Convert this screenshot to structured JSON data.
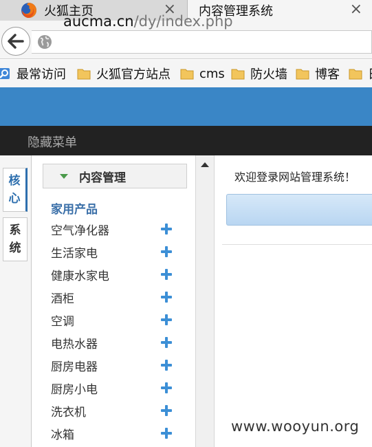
{
  "browser": {
    "tabs": [
      {
        "title": "火狐主页",
        "icon": "firefox-icon",
        "close": "×"
      },
      {
        "title": "内容管理系统",
        "close": "×"
      }
    ],
    "url_host": "aucma.cn",
    "url_path": "/dy/index.php",
    "bookmarks": [
      "最常访问",
      "火狐官方站点",
      "cms",
      "防火墙",
      "博客",
      "日"
    ]
  },
  "app": {
    "hide_menu": "隐藏菜单",
    "vertical_tabs": [
      "核心",
      "系统"
    ],
    "sidebar": {
      "header": "内容管理",
      "category": "家用产品",
      "items": [
        "空气净化器",
        "生活家电",
        "健康水家电",
        "酒柜",
        "空调",
        "电热水器",
        "厨房电器",
        "厨房小电",
        "洗衣机",
        "冰箱"
      ]
    },
    "welcome_text": "欢迎登录网站管理系统！"
  },
  "watermark": "www.wooyun.org",
  "colors": {
    "header_blue": "#3a86c6",
    "header_dark": "#222222",
    "accent_blue": "#3c8fd6",
    "category_blue": "#3a6fa8"
  }
}
